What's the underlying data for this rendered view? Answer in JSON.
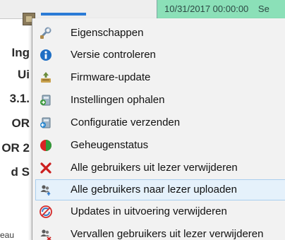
{
  "background": {
    "datetime_text": "10/31/2017 00:00:00",
    "datetime_extra": "Se",
    "cell_labels": [
      "Ing",
      "Ui",
      "3.1.",
      "OR",
      "OR 2",
      "d S"
    ],
    "bottom_left_text": "eau"
  },
  "menu": {
    "items": [
      {
        "label": "Eigenschappen",
        "icon": "wrench-icon"
      },
      {
        "label": "Versie controleren",
        "icon": "info-icon"
      },
      {
        "label": "Firmware-update",
        "icon": "firmware-update-icon"
      },
      {
        "label": "Instellingen ophalen",
        "icon": "fetch-settings-icon"
      },
      {
        "label": "Configuratie verzenden",
        "icon": "send-config-icon"
      },
      {
        "label": "Geheugenstatus",
        "icon": "memory-pie-icon"
      },
      {
        "label": "Alle gebruikers uit lezer verwijderen",
        "icon": "delete-x-icon"
      },
      {
        "label": "Alle gebruikers naar lezer uploaden",
        "icon": "upload-users-icon"
      },
      {
        "label": "Updates in uitvoering verwijderen",
        "icon": "no-updates-icon"
      },
      {
        "label": "Vervallen gebruikers uit lezer verwijderen",
        "icon": "expired-users-icon"
      }
    ],
    "highlighted_index": 7
  },
  "colors": {
    "datetime_cell": "#8be0b8",
    "menu_background": "#f2f2f2",
    "highlight_background": "#e5f1fb",
    "highlight_border": "#a9cfee"
  }
}
